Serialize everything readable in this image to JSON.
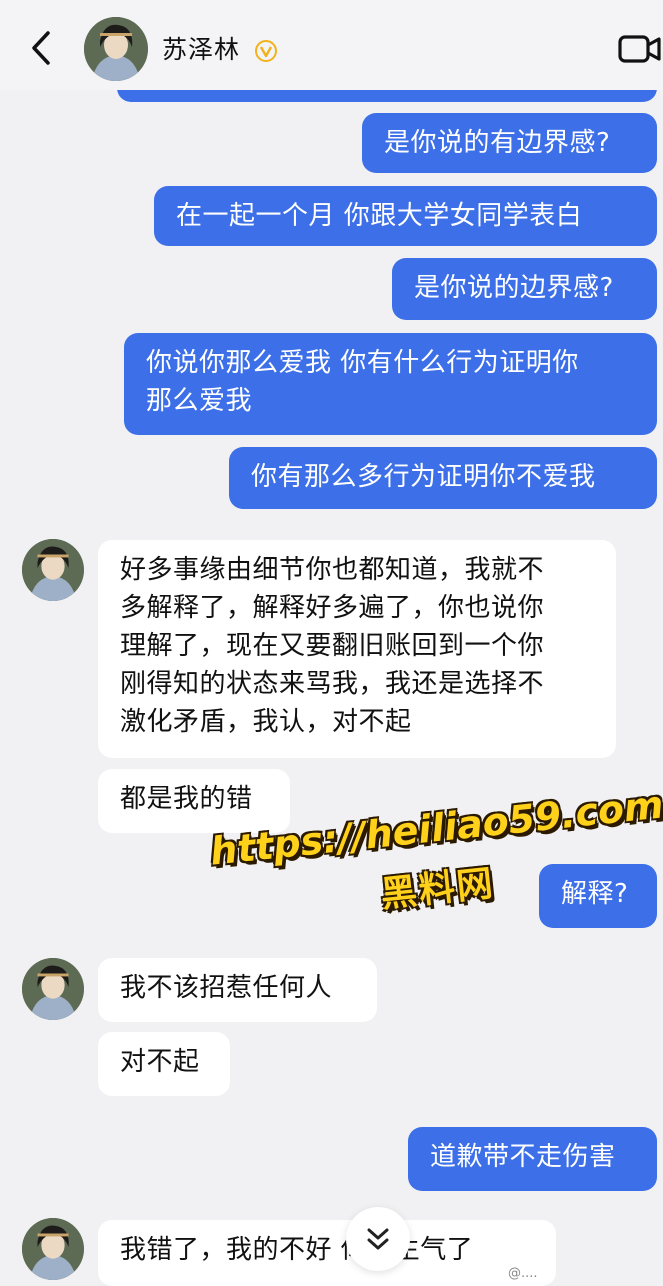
{
  "header": {
    "contact_name": "苏泽林",
    "back_icon": "chevron-left-icon",
    "verified_icon": "v-badge-icon",
    "video_icon": "video-camera-icon"
  },
  "messages": [
    {
      "sender": "me",
      "text": "是你说的有边界感?"
    },
    {
      "sender": "me",
      "text": "在一起一个月  你跟大学女同学表白"
    },
    {
      "sender": "me",
      "text": "是你说的边界感?"
    },
    {
      "sender": "me",
      "text": "你说你那么爱我  你有什么行为证明你\n那么爱我"
    },
    {
      "sender": "me",
      "text": "你有那么多行为证明你不爱我"
    },
    {
      "sender": "them",
      "text": "好多事缘由细节你也都知道，我就不\n多解释了，解释好多遍了，你也说你\n理解了，现在又要翻旧账回到一个你\n刚得知的状态来骂我，我还是选择不\n激化矛盾，我认，对不起"
    },
    {
      "sender": "them",
      "text": "都是我的错"
    },
    {
      "sender": "me",
      "text": "解释?"
    },
    {
      "sender": "them",
      "text": "我不该招惹任何人"
    },
    {
      "sender": "them",
      "text": "对不起"
    },
    {
      "sender": "me",
      "text": "道歉带不走伤害"
    },
    {
      "sender": "them",
      "text": "我错了，我的不好       你别生气了"
    }
  ],
  "watermark": {
    "url": "https://heiliao59.com",
    "name": "黑料网"
  },
  "scroll_down_icon": "double-chevron-down-icon",
  "footer_watermark": "@...."
}
